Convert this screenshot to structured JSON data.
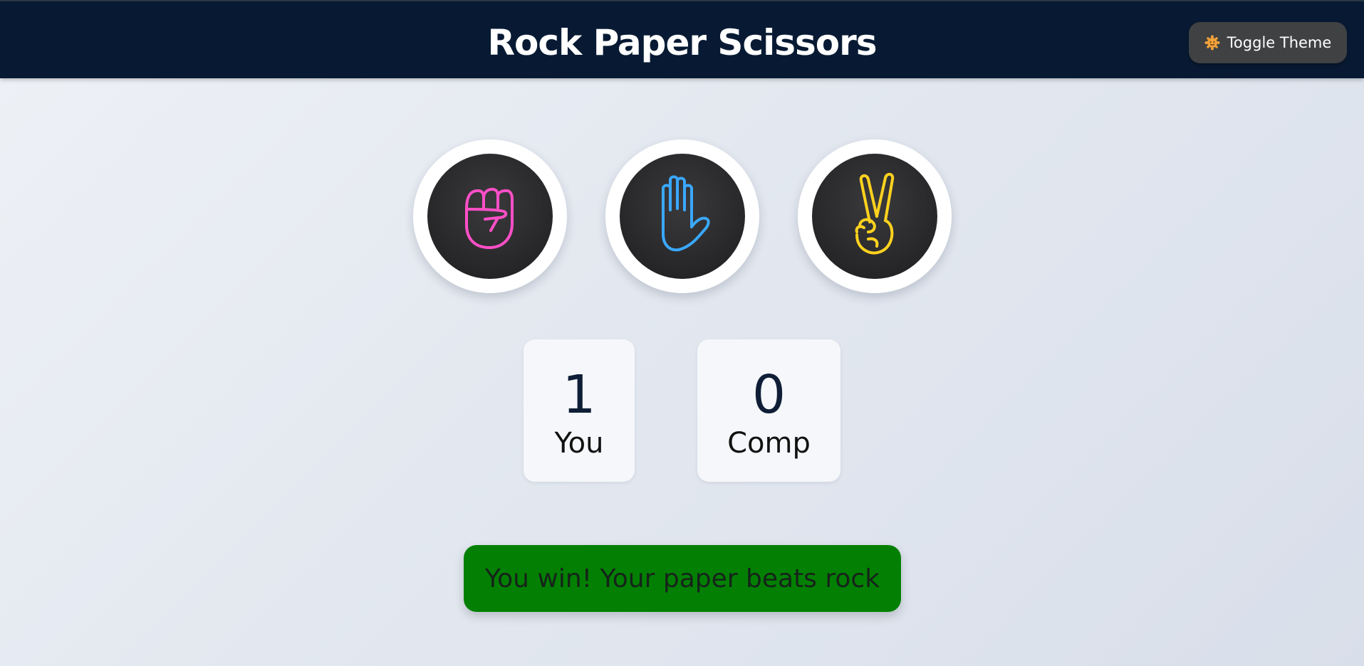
{
  "header": {
    "title": "Rock Paper Scissors",
    "theme_button": {
      "label": "Toggle Theme",
      "icon": "sun-face-icon"
    }
  },
  "choices": [
    {
      "name": "rock",
      "icon": "neon-fist-icon",
      "color": "#ff4fc8"
    },
    {
      "name": "paper",
      "icon": "neon-open-hand-icon",
      "color": "#3aa8ff"
    },
    {
      "name": "scissors",
      "icon": "neon-peace-hand-icon",
      "color": "#ffd21f"
    }
  ],
  "scores": {
    "user": {
      "value": "1",
      "label": "You"
    },
    "computer": {
      "value": "0",
      "label": "Comp"
    }
  },
  "result": {
    "message": "You win! Your paper beats rock",
    "color": "#038003"
  }
}
